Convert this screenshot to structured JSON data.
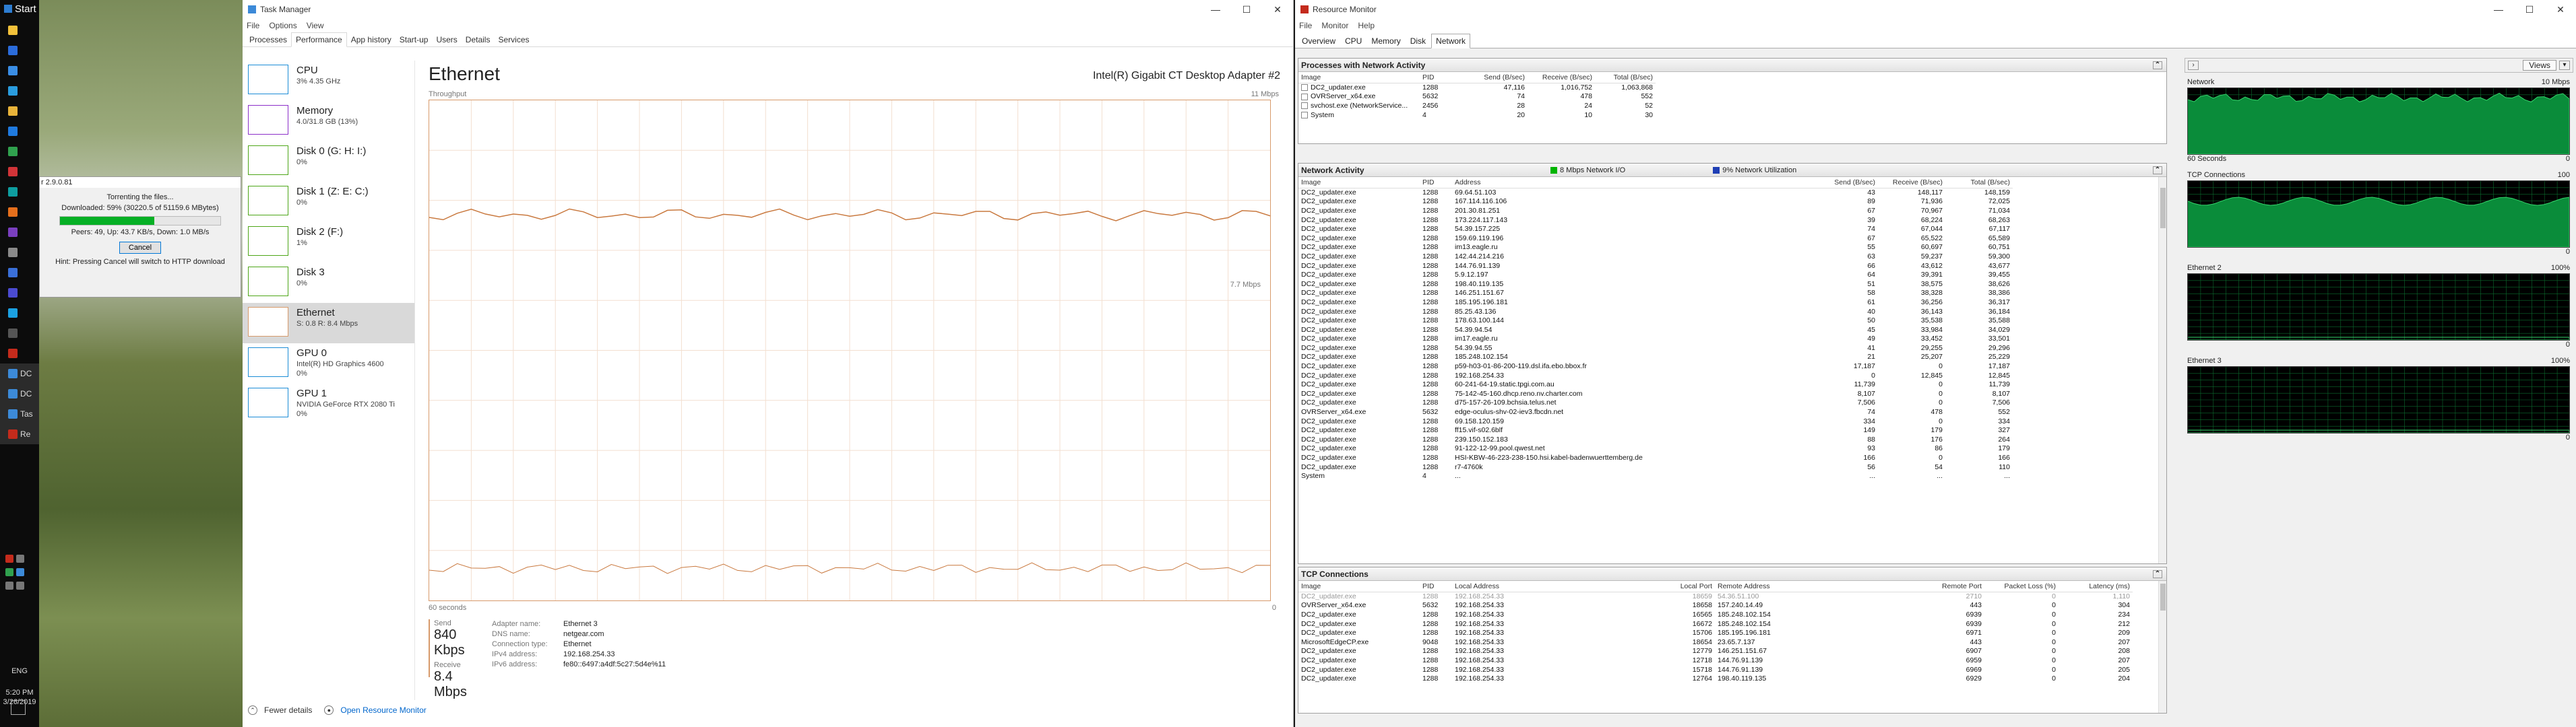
{
  "taskbar": {
    "start_label": "Start",
    "icons": [
      {
        "name": "file-explorer-icon",
        "color": "#f3c13a",
        "label": ""
      },
      {
        "name": "browser-icon",
        "color": "#2b6cdb",
        "label": ""
      },
      {
        "name": "store-icon",
        "color": "#3a8ee6",
        "label": ""
      },
      {
        "name": "mail-icon",
        "color": "#2a9cde",
        "label": ""
      },
      {
        "name": "folder-icon",
        "color": "#e8b33a",
        "label": ""
      },
      {
        "name": "app-blue-icon",
        "color": "#1f7adf",
        "label": ""
      },
      {
        "name": "app-green-icon",
        "color": "#30a14e",
        "label": ""
      },
      {
        "name": "app-red-icon",
        "color": "#d13438",
        "label": ""
      },
      {
        "name": "app-teal-icon",
        "color": "#0e9ea0",
        "label": ""
      },
      {
        "name": "app-orange-icon",
        "color": "#e56f1c",
        "label": ""
      },
      {
        "name": "app-purple-icon",
        "color": "#7a3fbf",
        "label": ""
      },
      {
        "name": "app-gray-icon",
        "color": "#8a8a8a",
        "label": ""
      },
      {
        "name": "app-blue2-icon",
        "color": "#3a6fd8",
        "label": ""
      },
      {
        "name": "app-indigo-icon",
        "color": "#4b4bd1",
        "label": ""
      },
      {
        "name": "app-cyan-icon",
        "color": "#1ba1e2",
        "label": ""
      },
      {
        "name": "app-dark-icon",
        "color": "#555555",
        "label": ""
      },
      {
        "name": "app-red2-icon",
        "color": "#c42b1c",
        "label": ""
      },
      {
        "name": "taskbar-dc-1-icon",
        "color": "#3c8ad8",
        "label": "DC"
      },
      {
        "name": "taskbar-dc-2-icon",
        "color": "#3c8ad8",
        "label": "DC"
      },
      {
        "name": "taskbar-tas-icon",
        "color": "#3c8ad8",
        "label": "Tas"
      },
      {
        "name": "taskbar-re-icon",
        "color": "#c42b1c",
        "label": "Re"
      }
    ],
    "lang": "ENG",
    "time": "5:20 PM",
    "date": "3/26/2019"
  },
  "popup": {
    "title": "r 2.9.0.81",
    "line1": "Torrenting the files...",
    "line2": "Downloaded: 59% (30220.5 of 51159.6 MBytes)",
    "progress": 0.59,
    "line3": "Peers: 49, Up: 43.7 KB/s, Down: 1.0 MB/s",
    "cancel_label": "Cancel",
    "hint": "Hint: Pressing Cancel will switch to HTTP download"
  },
  "taskmanager": {
    "title": "Task Manager",
    "controls": [
      "—",
      "☐",
      "✕"
    ],
    "menu": [
      "File",
      "Options",
      "View"
    ],
    "tabs": [
      "Processes",
      "Performance",
      "App history",
      "Start-up",
      "Users",
      "Details",
      "Services"
    ],
    "selected_tab": 1,
    "side": [
      {
        "name": "CPU",
        "value": "3% 4.35 GHz",
        "color": "#1b8cd6"
      },
      {
        "name": "Memory",
        "value": "4.0/31.8 GB (13%)",
        "color": "#8b2fc9"
      },
      {
        "name": "Disk 0 (G: H: I:)",
        "value": "0%",
        "color": "#4da618"
      },
      {
        "name": "Disk 1 (Z: E: C:)",
        "value": "0%",
        "color": "#4da618"
      },
      {
        "name": "Disk 2 (F:)",
        "value": "1%",
        "color": "#4da618"
      },
      {
        "name": "Disk 3",
        "value": "0%",
        "color": "#4da618"
      },
      {
        "name": "Ethernet",
        "value": "S: 0.8 R: 8.4 Mbps",
        "color": "#d79a6b"
      },
      {
        "name": "GPU 0",
        "value": "Intel(R) HD Graphics 4600\n0%",
        "color": "#1b8cd6"
      },
      {
        "name": "GPU 1",
        "value": "NVIDIA GeForce RTX 2080 Ti\n0%",
        "color": "#1b8cd6"
      }
    ],
    "main": {
      "title": "Ethernet",
      "adapter": "Intel(R) Gigabit CT Desktop Adapter #2",
      "throughput_label": "Throughput",
      "max_label": "11 Mbps",
      "mid_label": "7.7 Mbps",
      "x_left": "60 seconds",
      "x_right": "0",
      "send_label": "Send",
      "send_value": "840 Kbps",
      "receive_label": "Receive",
      "receive_value": "8.4 Mbps",
      "props": [
        {
          "k": "Adapter name:",
          "v": "Ethernet 3"
        },
        {
          "k": "DNS name:",
          "v": "netgear.com"
        },
        {
          "k": "Connection type:",
          "v": "Ethernet"
        },
        {
          "k": "IPv4 address:",
          "v": "192.168.254.33"
        },
        {
          "k": "IPv6 address:",
          "v": "fe80::6497:a4df:5c27:5d4e%11"
        }
      ]
    },
    "footer": {
      "fewer": "Fewer details",
      "open_rm": "Open Resource Monitor"
    }
  },
  "resmon": {
    "title": "Resource Monitor",
    "controls": [
      "—",
      "☐",
      "✕"
    ],
    "menu": [
      "File",
      "Monitor",
      "Help"
    ],
    "tabs": [
      "Overview",
      "CPU",
      "Memory",
      "Disk",
      "Network"
    ],
    "selected_tab": 4,
    "proc_section": {
      "title": "Processes with Network Activity",
      "headers": [
        "Image",
        "PID",
        "Send (B/sec)",
        "Receive (B/sec)",
        "Total (B/sec)"
      ],
      "rows": [
        [
          "DC2_updater.exe",
          "1288",
          "47,116",
          "1,016,752",
          "1,063,868"
        ],
        [
          "OVRServer_x64.exe",
          "5632",
          "74",
          "478",
          "552"
        ],
        [
          "svchost.exe (NetworkService...",
          "2456",
          "28",
          "24",
          "52"
        ],
        [
          "System",
          "4",
          "20",
          "10",
          "30"
        ]
      ]
    },
    "net_section": {
      "title": "Network Activity",
      "io_label": "8 Mbps Network I/O",
      "util_label": "9% Network Utilization",
      "io_color": "#00b400",
      "util_color": "#1f3fb5",
      "headers": [
        "Image",
        "PID",
        "Address",
        "Send (B/sec)",
        "Receive (B/sec)",
        "Total (B/sec)"
      ],
      "rows": [
        [
          "DC2_updater.exe",
          "1288",
          "69.64.51.103",
          "43",
          "148,117",
          "148,159"
        ],
        [
          "DC2_updater.exe",
          "1288",
          "167.114.116.106",
          "89",
          "71,936",
          "72,025"
        ],
        [
          "DC2_updater.exe",
          "1288",
          "201.30.81.251",
          "67",
          "70,967",
          "71,034"
        ],
        [
          "DC2_updater.exe",
          "1288",
          "173.224.117.143",
          "39",
          "68,224",
          "68,263"
        ],
        [
          "DC2_updater.exe",
          "1288",
          "54.39.157.225",
          "74",
          "67,044",
          "67,117"
        ],
        [
          "DC2_updater.exe",
          "1288",
          "159.69.119.196",
          "67",
          "65,522",
          "65,589"
        ],
        [
          "DC2_updater.exe",
          "1288",
          "im13.eagle.ru",
          "55",
          "60,697",
          "60,751"
        ],
        [
          "DC2_updater.exe",
          "1288",
          "142.44.214.216",
          "63",
          "59,237",
          "59,300"
        ],
        [
          "DC2_updater.exe",
          "1288",
          "144.76.91.139",
          "66",
          "43,612",
          "43,677"
        ],
        [
          "DC2_updater.exe",
          "1288",
          "5.9.12.197",
          "64",
          "39,391",
          "39,455"
        ],
        [
          "DC2_updater.exe",
          "1288",
          "198.40.119.135",
          "51",
          "38,575",
          "38,626"
        ],
        [
          "DC2_updater.exe",
          "1288",
          "146.251.151.67",
          "58",
          "38,328",
          "38,386"
        ],
        [
          "DC2_updater.exe",
          "1288",
          "185.195.196.181",
          "61",
          "36,256",
          "36,317"
        ],
        [
          "DC2_updater.exe",
          "1288",
          "85.25.43.136",
          "40",
          "36,143",
          "36,184"
        ],
        [
          "DC2_updater.exe",
          "1288",
          "178.63.100.144",
          "50",
          "35,538",
          "35,588"
        ],
        [
          "DC2_updater.exe",
          "1288",
          "54.39.94.54",
          "45",
          "33,984",
          "34,029"
        ],
        [
          "DC2_updater.exe",
          "1288",
          "im17.eagle.ru",
          "49",
          "33,452",
          "33,501"
        ],
        [
          "DC2_updater.exe",
          "1288",
          "54.39.94.55",
          "41",
          "29,255",
          "29,296"
        ],
        [
          "DC2_updater.exe",
          "1288",
          "185.248.102.154",
          "21",
          "25,207",
          "25,229"
        ],
        [
          "DC2_updater.exe",
          "1288",
          "p59-h03-01-86-200-119.dsl.ifa.ebo.bbox.fr",
          "17,187",
          "0",
          "17,187"
        ],
        [
          "DC2_updater.exe",
          "1288",
          "192.168.254.33",
          "0",
          "12,845",
          "12,845"
        ],
        [
          "DC2_updater.exe",
          "1288",
          "60-241-64-19.static.tpgi.com.au",
          "11,739",
          "0",
          "11,739"
        ],
        [
          "DC2_updater.exe",
          "1288",
          "75-142-45-160.dhcp.reno.nv.charter.com",
          "8,107",
          "0",
          "8,107"
        ],
        [
          "DC2_updater.exe",
          "1288",
          "d75-157-26-109.bchsia.telus.net",
          "7,506",
          "0",
          "7,506"
        ],
        [
          "OVRServer_x64.exe",
          "5632",
          "edge-oculus-shv-02-iev3.fbcdn.net",
          "74",
          "478",
          "552"
        ],
        [
          "DC2_updater.exe",
          "1288",
          "69.158.120.159",
          "334",
          "0",
          "334"
        ],
        [
          "DC2_updater.exe",
          "1288",
          "ff15.vif-s02.6blf",
          "149",
          "179",
          "327"
        ],
        [
          "DC2_updater.exe",
          "1288",
          "239.150.152.183",
          "88",
          "176",
          "264"
        ],
        [
          "DC2_updater.exe",
          "1288",
          "91-122-12-99.pool.qwest.net",
          "93",
          "86",
          "179"
        ],
        [
          "DC2_updater.exe",
          "1288",
          "HSI-KBW-46-223-238-150.hsi.kabel-badenwuerttemberg.de",
          "166",
          "0",
          "166"
        ],
        [
          "DC2_updater.exe",
          "1288",
          "r7-4760k",
          "56",
          "54",
          "110"
        ],
        [
          "System",
          "4",
          "...",
          "...",
          "...",
          "..."
        ]
      ]
    },
    "tcp_section": {
      "title": "TCP Connections",
      "headers": [
        "Image",
        "PID",
        "Local Address",
        "Local Port",
        "Remote Address",
        "Remote Port",
        "Packet Loss (%)",
        "Latency (ms)"
      ],
      "rows": [
        [
          "DC2_updater.exe",
          "1288",
          "192.168.254.33",
          "18659",
          "54.36.51.100",
          "2710",
          "0",
          "1,110"
        ],
        [
          "OVRServer_x64.exe",
          "5632",
          "192.168.254.33",
          "18658",
          "157.240.14.49",
          "443",
          "0",
          "304"
        ],
        [
          "DC2_updater.exe",
          "1288",
          "192.168.254.33",
          "16565",
          "185.248.102.154",
          "6939",
          "0",
          "234"
        ],
        [
          "DC2_updater.exe",
          "1288",
          "192.168.254.33",
          "16672",
          "185.248.102.154",
          "6939",
          "0",
          "212"
        ],
        [
          "DC2_updater.exe",
          "1288",
          "192.168.254.33",
          "15706",
          "185.195.196.181",
          "6971",
          "0",
          "209"
        ],
        [
          "MicrosoftEdgeCP.exe",
          "9048",
          "192.168.254.33",
          "18654",
          "23.65.7.137",
          "443",
          "0",
          "207"
        ],
        [
          "DC2_updater.exe",
          "1288",
          "192.168.254.33",
          "12779",
          "146.251.151.67",
          "6907",
          "0",
          "208"
        ],
        [
          "DC2_updater.exe",
          "1288",
          "192.168.254.33",
          "12718",
          "144.76.91.139",
          "6959",
          "0",
          "207"
        ],
        [
          "DC2_updater.exe",
          "1288",
          "192.168.254.33",
          "15718",
          "144.76.91.139",
          "6969",
          "0",
          "205"
        ],
        [
          "DC2_updater.exe",
          "1288",
          "192.168.254.33",
          "12764",
          "198.40.119.135",
          "6929",
          "0",
          "204"
        ]
      ]
    },
    "right": {
      "views_label": "Views",
      "graphs": [
        {
          "title": "Network",
          "max": "10 Mbps",
          "foot_left": "60 Seconds",
          "foot_right": "0"
        },
        {
          "title": "TCP Connections",
          "max": "100",
          "foot_left": "",
          "foot_right": "0"
        },
        {
          "title": "Ethernet 2",
          "max": "100%",
          "foot_left": "",
          "foot_right": "0"
        },
        {
          "title": "Ethernet 3",
          "max": "100%",
          "foot_left": "",
          "foot_right": "0"
        }
      ]
    }
  }
}
